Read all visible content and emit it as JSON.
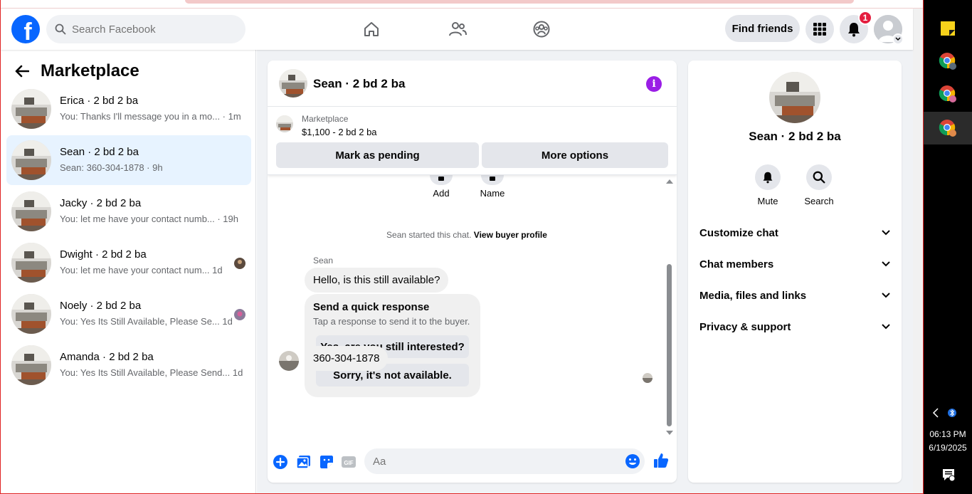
{
  "header": {
    "logo_letter": "f",
    "search_placeholder": "Search Facebook",
    "find_friends_label": "Find friends",
    "notifications_count": "1"
  },
  "sidebar": {
    "title": "Marketplace",
    "conversations": [
      {
        "name": "Erica · 2 bd 2 ba",
        "preview": "You: Thanks I'll message you in a mo... · 1m",
        "active": false
      },
      {
        "name": "Sean · 2 bd 2 ba",
        "preview": "Sean: 360-304-1878 · 9h",
        "active": true
      },
      {
        "name": "Jacky · 2 bd 2 ba",
        "preview": "You: let me have your contact numb... · 19h",
        "active": false
      },
      {
        "name": "Dwight · 2 bd 2 ba",
        "preview": "You: let me have your contact num...  1d",
        "active": false
      },
      {
        "name": "Noely · 2 bd 2 ba",
        "preview": "You: Yes Its Still Available, Please Se...  1d",
        "active": false
      },
      {
        "name": "Amanda · 2 bd 2 ba",
        "preview": "You: Yes Its Still Available, Please Send...  1d",
        "active": false
      }
    ]
  },
  "chat": {
    "title": "Sean · 2 bd 2 ba",
    "listing_category": "Marketplace",
    "listing_price": "$1,100 - 2 bd 2 ba",
    "mark_pending_label": "Mark as pending",
    "more_options_label": "More options",
    "add_label": "Add",
    "name_label": "Name",
    "system_text": "Sean started this chat.",
    "view_buyer_label": "View buyer profile",
    "sender_name": "Sean",
    "message_1": "Hello, is this still available?",
    "quick_title": "Send a quick response",
    "quick_subtitle": "Tap a response to send it to the buyer.",
    "quick_reply_1": "Yes, are you still interested?",
    "quick_reply_2": "Sorry, it's not available.",
    "message_2": "360-304-1878",
    "composer_placeholder": "Aa"
  },
  "details": {
    "title": "Sean · 2 bd 2 ba",
    "mute_label": "Mute",
    "search_label": "Search",
    "sections": [
      "Customize chat",
      "Chat members",
      "Media, files and links",
      "Privacy & support"
    ]
  },
  "taskbar": {
    "time": "06:13 PM",
    "date": "6/19/2025"
  },
  "colors": {
    "brand_blue": "#0866ff",
    "active_row": "#e7f3ff",
    "info_purple": "#9a1ee6",
    "badge_red": "#e41e3f"
  }
}
